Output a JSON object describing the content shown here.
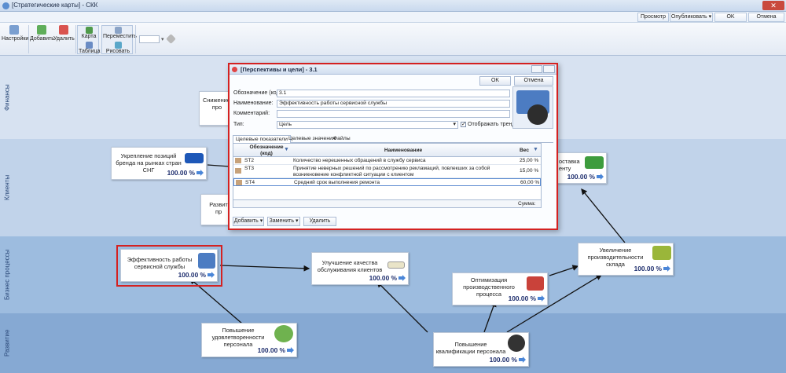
{
  "window": {
    "title": "[Стратегические карты] - СКК",
    "close_label": "✕"
  },
  "top_buttons": {
    "preview": "Просмотр",
    "publish": "Опубликовать",
    "ok": "OK",
    "cancel": "Отмена"
  },
  "ribbon": {
    "settings": "Настройки",
    "add": "Добавить",
    "delete": "Удалить",
    "map": "Карта",
    "table": "Таблица",
    "move": "Переместить",
    "draw": "Рисовать"
  },
  "lanes": [
    {
      "label": "Финансы",
      "color": "#d7e2f1"
    },
    {
      "label": "Клиенты",
      "color": "#c1d3ea"
    },
    {
      "label": "Бизнес процессы",
      "color": "#9dbcdf"
    },
    {
      "label": "Развитие",
      "color": "#86a9d3"
    }
  ],
  "nodes": {
    "cost": {
      "title": "Снижение з\nпро",
      "value": ""
    },
    "brand": {
      "title": "Укрепление позиций\nбренда на рынках стран\nСНГ",
      "value": "100.00 %"
    },
    "develop": {
      "title": "Развит\nпр",
      "value": ""
    },
    "delivery": {
      "title": "оставка\nенту",
      "value": "100.00 %"
    },
    "service": {
      "title": "Эффективность работы\nсервисной службы",
      "value": "100.00 %"
    },
    "quality": {
      "title": "Улучшение качества\nобслуживания клиентов",
      "value": "100.00 %"
    },
    "warehouse": {
      "title": "Увеличение\nпроизводительности\nсклада",
      "value": "100.00 %"
    },
    "optimize": {
      "title": "Оптимизация\nпроизводственного\nпроцесса",
      "value": "100.00 %"
    },
    "satisfaction": {
      "title": "Повышение\nудовлетворенности\nперсонала",
      "value": "100.00 %"
    },
    "qualification": {
      "title": "Повышение\nквалификации персонала",
      "value": "100.00 %"
    }
  },
  "dialog": {
    "title": "[Перспективы и цели] - 3.1",
    "ok": "OK",
    "cancel": "Отмена",
    "code_label": "Обозначение (код):",
    "code_value": "3.1",
    "name_label": "Наименование:",
    "name_value": "Эффективность работы сервисной службы",
    "comment_label": "Комментарий:",
    "comment_value": "",
    "type_label": "Тип:",
    "type_value": "Цель",
    "show_trend": "Отображать тренд",
    "tabs": [
      "Целевые показатели",
      "Целевые значения",
      "Файлы"
    ],
    "grid_headers": {
      "code": "Обозначение (код)",
      "name": "Наименование",
      "weight": "Вес"
    },
    "rows": [
      {
        "code": "ST2",
        "name": "Количество нерешенных обращений в службу сервиса",
        "weight": "25,00 %"
      },
      {
        "code": "ST3",
        "name": "Принятие неверных решений по рассмотрению рекламаций, повлекших за собой возникновение конфликтной ситуации с клиентом",
        "weight": "15,00 %"
      },
      {
        "code": "ST4",
        "name": "Средний срок выполнения ремонта",
        "weight": "60,00 %"
      }
    ],
    "sum_label": "Сумма:",
    "footer": {
      "add": "Добавить",
      "replace": "Заменить",
      "delete": "Удалить"
    }
  }
}
